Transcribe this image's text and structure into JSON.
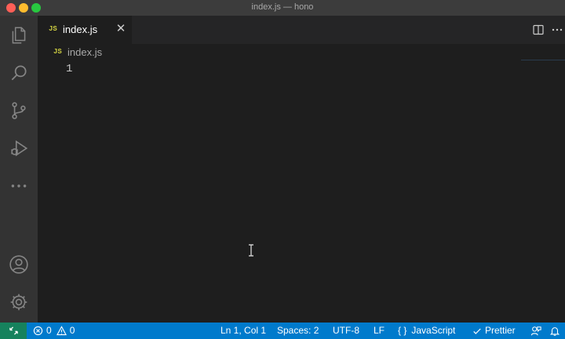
{
  "window": {
    "title": "index.js — hono"
  },
  "activity_bar": {
    "items": [
      "files-icon",
      "search-icon",
      "source-control-icon",
      "run-debug-icon",
      "more-icon"
    ],
    "bottom_items": [
      "account-icon",
      "settings-gear-icon"
    ]
  },
  "tab": {
    "badge": "JS",
    "label": "index.js",
    "close_glyph": "✕"
  },
  "breadcrumb": {
    "badge": "JS",
    "label": "index.js"
  },
  "editor": {
    "line_numbers": [
      "1"
    ],
    "content": ""
  },
  "status_bar": {
    "errors": "0",
    "warnings": "0",
    "position": "Ln 1, Col 1",
    "indentation": "Spaces: 2",
    "encoding": "UTF-8",
    "eol": "LF",
    "language": "JavaScript",
    "language_glyph": "{ }",
    "formatter": "Prettier"
  },
  "colors": {
    "status_bar": "#007acc",
    "remote_indicator": "#16825d",
    "js_badge": "#cbcb41",
    "editor_bg": "#1e1e1e",
    "activity_bar_bg": "#333333"
  }
}
